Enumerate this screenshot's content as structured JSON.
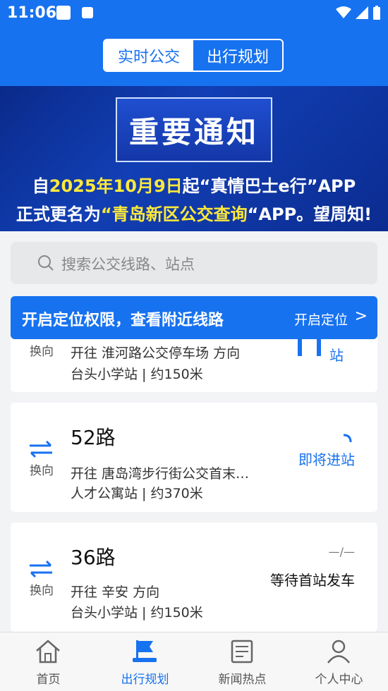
{
  "status_bar": {
    "time": "11:06"
  },
  "header": {
    "tabs": [
      {
        "label": "实时公交",
        "active": true
      },
      {
        "label": "出行规划",
        "active": false
      }
    ]
  },
  "banner": {
    "title": "重要通知",
    "line1": {
      "a": "自",
      "b": "2025年10月9日",
      "c": "起“真情巴士e行”APP"
    },
    "line2": {
      "a": "正式更名为",
      "b": "“青岛新区公交查询",
      "c": "“APP。望周知!"
    }
  },
  "search": {
    "placeholder": "搜索公交线路、站点"
  },
  "location_bar": {
    "text": "开启定位权限，查看附近线路",
    "action": "开启定位",
    "chevron": ">"
  },
  "routes": [
    {
      "swap_label": "换向",
      "route": "",
      "direction": "开往 淮河路公交停车场 方向",
      "stop": "台头小学站 | 约150米",
      "status": "站",
      "status_icon": "bars"
    },
    {
      "swap_label": "换向",
      "route": "52路",
      "direction": "开往 唐岛湾步行街公交首末…",
      "stop": "人才公寓站 | 约370米",
      "status": "即将进站",
      "status_icon": "loading-arc"
    },
    {
      "swap_label": "换向",
      "route": "36路",
      "direction": "开往 辛安 方向",
      "stop": "台头小学站 | 约150米",
      "status": "等待首站发车",
      "status_extra": "—/—"
    }
  ],
  "tabbar": [
    {
      "label": "首页",
      "icon": "home-icon",
      "active": false
    },
    {
      "label": "出行规划",
      "icon": "flag-icon",
      "active": true
    },
    {
      "label": "新闻热点",
      "icon": "news-icon",
      "active": false
    },
    {
      "label": "个人中心",
      "icon": "user-icon",
      "active": false
    }
  ],
  "colors": {
    "primary": "#1772f0",
    "banner_bg": "#0f33a6",
    "highlight": "#ffe93a"
  }
}
